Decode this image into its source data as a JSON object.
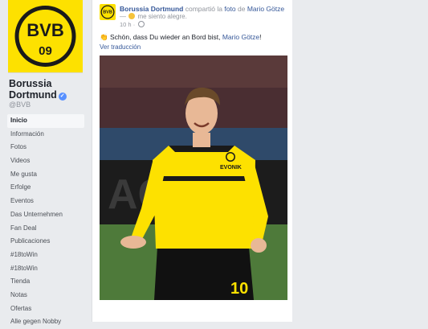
{
  "sidebar": {
    "page_name": "Borussia Dortmund",
    "handle": "@BVB",
    "items": [
      {
        "label": "Inicio",
        "active": true
      },
      {
        "label": "Información"
      },
      {
        "label": "Fotos"
      },
      {
        "label": "Videos"
      },
      {
        "label": "Me gusta"
      },
      {
        "label": "Erfolge"
      },
      {
        "label": "Eventos"
      },
      {
        "label": "Das Unternehmen"
      },
      {
        "label": "Fan Deal"
      },
      {
        "label": "Publicaciones"
      },
      {
        "label": "#18toWin"
      },
      {
        "label": "#18toWin"
      },
      {
        "label": "Tienda"
      },
      {
        "label": "Notas"
      },
      {
        "label": "Ofertas"
      },
      {
        "label": "Alle gegen Nobby"
      }
    ]
  },
  "post": {
    "author": "Borussia Dortmund",
    "action": "compartió la",
    "action_object": "foto",
    "action_prep": "de",
    "tagged": "Mario Götze",
    "feeling": "me siento alegre.",
    "time": "10 h",
    "text": "Schön, dass Du wieder an Bord bist,",
    "text_mention": "Mario Götze",
    "text_end": "!",
    "translate_label": "Ver traducción"
  },
  "photo": {
    "shirt_number": "10",
    "sponsor": "EVONIK",
    "background_text": "ACT"
  },
  "colors": {
    "brand_yellow": "#fde100",
    "facebook_blue": "#365899",
    "sidebar_bg": "#e9ebee"
  }
}
